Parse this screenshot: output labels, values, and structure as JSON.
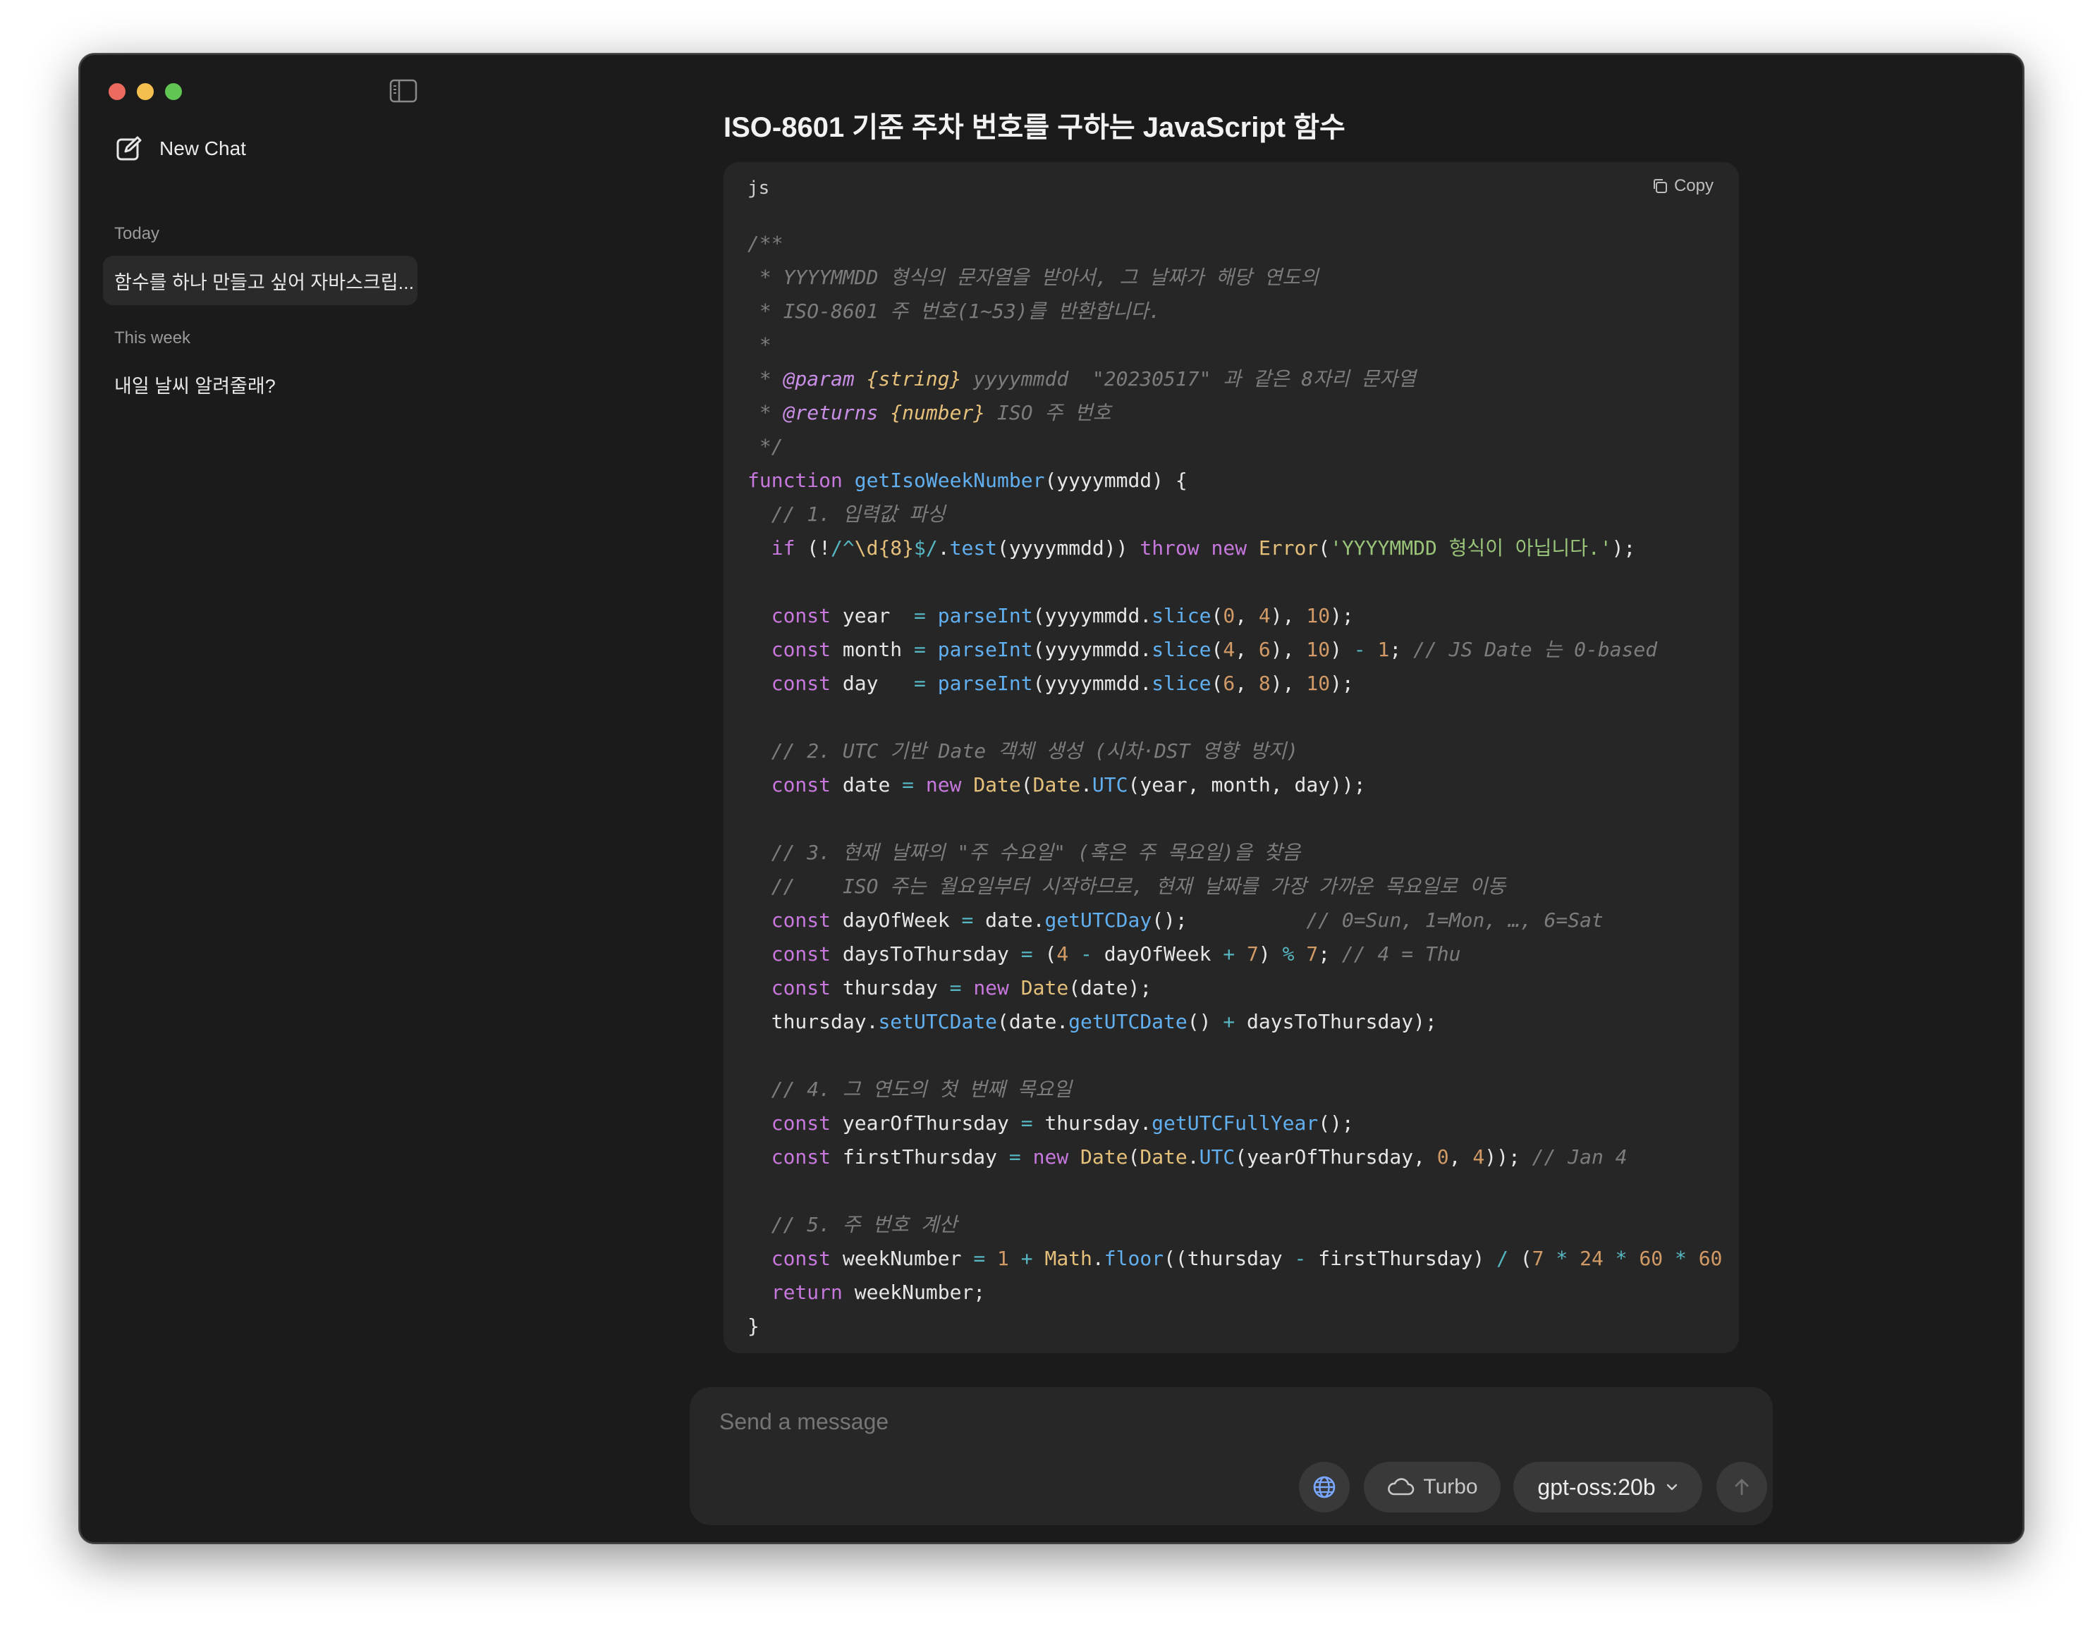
{
  "sidebar": {
    "new_chat_label": "New Chat",
    "sections": [
      {
        "label": "Today",
        "items": [
          "함수를 하나 만들고 싶어 자바스크립..."
        ]
      },
      {
        "label": "This week",
        "items": [
          "내일 날씨 알려줄래?"
        ]
      }
    ]
  },
  "main": {
    "title": "ISO-8601 기준 주차 번호를 구하는 JavaScript 함수",
    "code_block": {
      "language": "js",
      "copy_label": "Copy",
      "code": "/**\n * YYYYMMDD 형식의 문자열을 받아서, 그 날짜가 해당 연도의\n * ISO-8601 주 번호(1~53)를 반환합니다.\n *\n * @param {string} yyyymmdd  \"20230517\" 과 같은 8자리 문자열\n * @returns {number} ISO 주 번호\n */\nfunction getIsoWeekNumber(yyyymmdd) {\n  // 1. 입력값 파싱\n  if (!/^\\d{8}$/.test(yyyymmdd)) throw new Error('YYYYMMDD 형식이 아닙니다.');\n\n  const year  = parseInt(yyyymmdd.slice(0, 4), 10);\n  const month = parseInt(yyyymmdd.slice(4, 6), 10) - 1; // JS Date 는 0-based\n  const day   = parseInt(yyyymmdd.slice(6, 8), 10);\n\n  // 2. UTC 기반 Date 객체 생성 (시차·DST 영향 방지)\n  const date = new Date(Date.UTC(year, month, day));\n\n  // 3. 현재 날짜의 \"주 수요일\" (혹은 주 목요일)을 찾음\n  //    ISO 주는 월요일부터 시작하므로, 현재 날짜를 가장 가까운 목요일로 이동\n  const dayOfWeek = date.getUTCDay();          // 0=Sun, 1=Mon, …, 6=Sat\n  const daysToThursday = (4 - dayOfWeek + 7) % 7; // 4 = Thu\n  const thursday = new Date(date);\n  thursday.setUTCDate(date.getUTCDate() + daysToThursday);\n\n  // 4. 그 연도의 첫 번째 목요일\n  const yearOfThursday = thursday.getUTCFullYear();\n  const firstThursday = new Date(Date.UTC(yearOfThursday, 0, 4)); // Jan 4\n\n  // 5. 주 번호 계산\n  const weekNumber = 1 + Math.floor((thursday - firstThursday) / (7 * 24 * 60 * 60\n  return weekNumber;\n}"
    }
  },
  "composer": {
    "placeholder": "Send a message",
    "turbo_label": "Turbo",
    "model_label": "gpt-oss:20b"
  },
  "icons": {
    "new_chat": "compose-icon",
    "sidebar_toggle": "sidebar-toggle-icon",
    "copy": "copy-icon",
    "globe": "globe-icon",
    "turbo": "cloud-icon",
    "model_chevron": "chevron-down-icon",
    "send": "arrow-up-icon"
  },
  "colors": {
    "window_bg": "#1b1b1b",
    "code_bg": "#262626",
    "globe_accent": "#7aa7ff",
    "traffic_red": "#ec6a5e",
    "traffic_yellow": "#f4bf4f",
    "traffic_green": "#61c554"
  }
}
